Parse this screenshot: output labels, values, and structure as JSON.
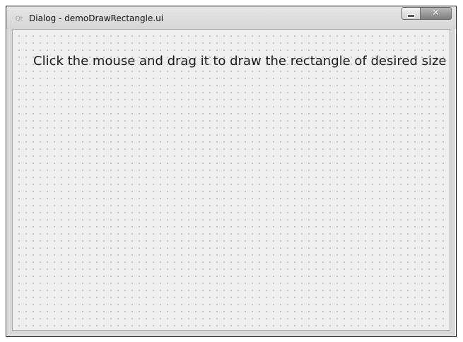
{
  "window": {
    "title": "Dialog - demoDrawRectangle.ui",
    "app_icon": "qt-icon",
    "minimize_icon": "minimize-icon",
    "close_icon": "close-icon"
  },
  "content": {
    "instruction": "Click the mouse and drag it to draw the rectangle of desired size"
  }
}
